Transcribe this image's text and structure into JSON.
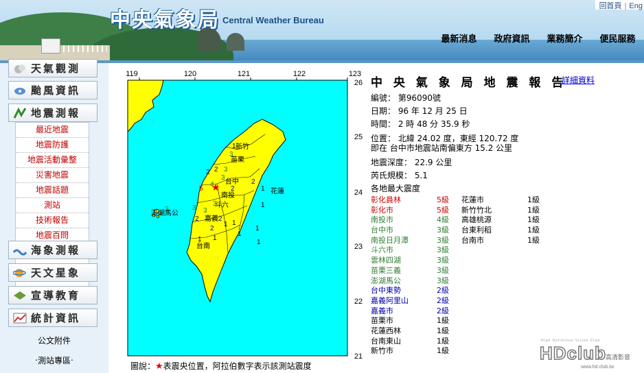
{
  "header": {
    "logo_cn": "中央氣象局",
    "logo_en": "Central Weather Bureau",
    "home_link": "回首頁",
    "lang_link": "Eng",
    "nav": [
      "最新消息",
      "政府資訊",
      "業務簡介",
      "便民服務"
    ]
  },
  "sidebar": {
    "buttons": [
      {
        "label": "天氣觀測",
        "icon": "weather-observation-icon"
      },
      {
        "label": "颱風資訊",
        "icon": "typhoon-icon"
      },
      {
        "label": "地震測報",
        "icon": "earthquake-icon"
      },
      {
        "label": "海象測報",
        "icon": "ocean-icon"
      },
      {
        "label": "天文星象",
        "icon": "astronomy-icon"
      },
      {
        "label": "宣導教育",
        "icon": "education-icon"
      },
      {
        "label": "統計資訊",
        "icon": "statistics-icon"
      }
    ],
    "earthquake_sub": [
      "最近地震",
      "地震防護",
      "地震活動彙整",
      "災害地震",
      "地震話題",
      "測站",
      "技術報告",
      "地震百問"
    ],
    "attachments": "公文附件",
    "station_zone": "‧測站專區‧"
  },
  "map": {
    "lon_labels": [
      "119",
      "120",
      "121",
      "122",
      "123"
    ],
    "lat_labels": [
      "26",
      "25",
      "24",
      "23",
      "22",
      "21"
    ],
    "place_labels": [
      "新竹",
      "苗栗",
      "台中",
      "南投",
      "花蓮",
      "斗六",
      "嘉義",
      "澎湖馬公",
      "台南"
    ],
    "epicenter": {
      "lon": 120.72,
      "lat": 24.02
    },
    "land_color": "#ffff00",
    "sea_color": "#00ffff"
  },
  "report": {
    "title": "中 央 氣 象 局 地 震 報 告",
    "detail_link": "詳細資料",
    "number": "編號： 第96090號",
    "date": "日期： 96 年 12 月 25 日",
    "time": "時間： 2 時 48 分 35.9 秒",
    "location": "位置： 北緯 24.02 度，東經 120.72 度",
    "location2": "即在 台中市地震站南偏東方 15.2 公里",
    "depth": "地震深度： 22.9 公里",
    "magnitude": "芮氏規模： 5.1",
    "intensity_header": "各地最大震度",
    "intensity_left": [
      {
        "station": "彰化員林",
        "level": "5級",
        "n": 5
      },
      {
        "station": "彰化市",
        "level": "5級",
        "n": 5
      },
      {
        "station": "南投市",
        "level": "4級",
        "n": 4
      },
      {
        "station": "台中市",
        "level": "3級",
        "n": 3
      },
      {
        "station": "南投日月潭",
        "level": "3級",
        "n": 3
      },
      {
        "station": "斗六市",
        "level": "3級",
        "n": 3
      },
      {
        "station": "雲林四湖",
        "level": "3級",
        "n": 3
      },
      {
        "station": "苗栗三義",
        "level": "3級",
        "n": 3
      },
      {
        "station": "澎湖馬公",
        "level": "3級",
        "n": 3
      },
      {
        "station": "台中東勢",
        "level": "2級",
        "n": 2
      },
      {
        "station": "嘉義阿里山",
        "level": "2級",
        "n": 2
      },
      {
        "station": "嘉義市",
        "level": "2級",
        "n": 2
      },
      {
        "station": "苗栗市",
        "level": "1級",
        "n": 1
      },
      {
        "station": "花蓮西林",
        "level": "1級",
        "n": 1
      },
      {
        "station": "台南東山",
        "level": "1級",
        "n": 1
      },
      {
        "station": "新竹市",
        "level": "1級",
        "n": 1
      }
    ],
    "intensity_right": [
      {
        "station": "花蓮市",
        "level": "1級",
        "n": 1
      },
      {
        "station": "新竹竹北",
        "level": "1級",
        "n": 1
      },
      {
        "station": "高雄桃源",
        "level": "1級",
        "n": 1
      },
      {
        "station": "台東利稻",
        "level": "1級",
        "n": 1
      },
      {
        "station": "台南市",
        "level": "1級",
        "n": 1
      }
    ]
  },
  "caption": {
    "prefix": "圖說：",
    "star": "★",
    "text": "表震央位置，阿拉伯數字表示該測站震度"
  },
  "watermark": {
    "small": "High Definition Vision Club",
    "big": "HDclub",
    "cn": "高清影音",
    "url": "www.hd.club.tw"
  }
}
